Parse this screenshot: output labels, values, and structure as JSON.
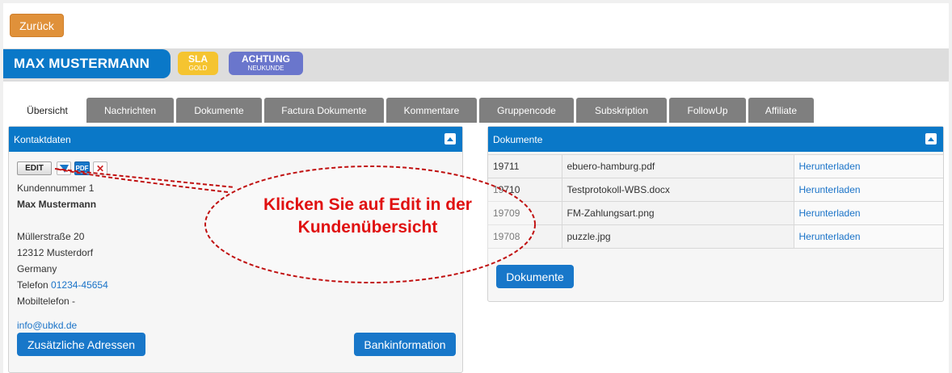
{
  "nav": {
    "back_label": "Zurück"
  },
  "customer": {
    "name": "MAX MUSTERMANN",
    "badges": [
      {
        "main": "SLA",
        "sub": "GOLD",
        "color": "#f5c430"
      },
      {
        "main": "ACHTUNG",
        "sub": "NEUKUNDE",
        "color": "#6a76cc"
      }
    ]
  },
  "tabs": [
    "Übersicht",
    "Nachrichten",
    "Dokumente",
    "Factura Dokumente",
    "Kommentare",
    "Gruppencode",
    "Subskription",
    "FollowUp",
    "Affiliate"
  ],
  "contact_panel": {
    "title": "Kontaktdaten",
    "edit_label": "EDIT",
    "pdf_label": "PDF",
    "customer_number": "Kundennummer 1",
    "name": "Max Mustermann",
    "street": "Müllerstraße 20",
    "city": "12312 Musterdorf",
    "country": "Germany",
    "phone_label": "Telefon",
    "phone": "01234-45654",
    "mobile": "Mobiltelefon -",
    "email": "info@ubkd.de",
    "btn_addresses": "Zusätzliche Adressen",
    "btn_bank": "Bankinformation"
  },
  "documents_panel": {
    "title": "Dokumente",
    "rows": [
      {
        "id": "19711",
        "file": "ebuero-hamburg.pdf",
        "action": "Herunterladen"
      },
      {
        "id": "19710",
        "file": "Testprotokoll-WBS.docx",
        "action": "Herunterladen"
      },
      {
        "id": "19709",
        "file": "FM-Zahlungsart.png",
        "action": "Herunterladen"
      },
      {
        "id": "19708",
        "file": "puzzle.jpg",
        "action": "Herunterladen"
      }
    ],
    "btn_label": "Dokumente"
  },
  "annotation": {
    "line1": "Klicken Sie auf Edit in der",
    "line2": "Kundenübersicht",
    "color": "#e01010"
  },
  "colors": {
    "primary": "#0a78c8",
    "back_button": "#e0913a",
    "tab_inactive": "#7f7f7f"
  }
}
